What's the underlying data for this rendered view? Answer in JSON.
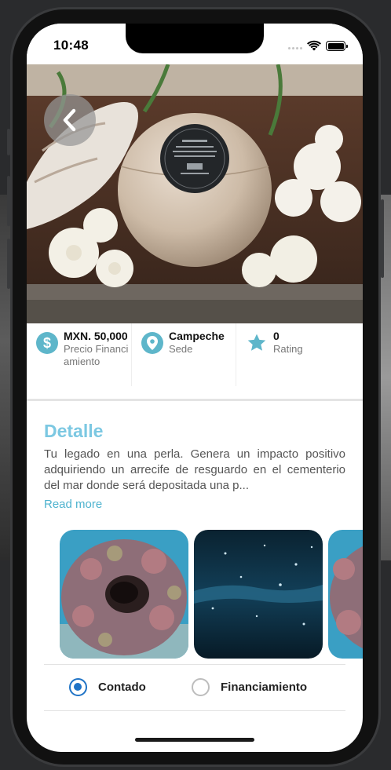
{
  "status_bar": {
    "time": "10:48"
  },
  "hero": {
    "back_icon": "chevron-left-icon"
  },
  "stats": [
    {
      "icon": "dollar-icon",
      "glyph": "$",
      "value": "MXN. 50,000",
      "label": "Precio Financiamiento"
    },
    {
      "icon": "location-pin-icon",
      "value": "Campeche",
      "label": "Sede"
    },
    {
      "icon": "star-icon",
      "value": "0",
      "label": "Rating"
    }
  ],
  "detail": {
    "title": "Detalle",
    "description": "Tu legado en una perla. Genera un impacto positivo adquiriendo un arrecife de resguardo en el cementerio del mar donde será depositada una p...",
    "read_more": "Read more"
  },
  "gallery": {
    "items": [
      {
        "name": "reef-ball-photo"
      },
      {
        "name": "underwater-surface-photo"
      },
      {
        "name": "reef-ball-photo-partial"
      }
    ]
  },
  "payment_options": {
    "selected": "Contado",
    "options": [
      "Contado",
      "Financiamiento"
    ]
  },
  "colors": {
    "accent": "#7cc8e2",
    "icon_bg": "#5eb6ca",
    "radio_selected": "#1f73c6",
    "link": "#4fb3cf"
  }
}
